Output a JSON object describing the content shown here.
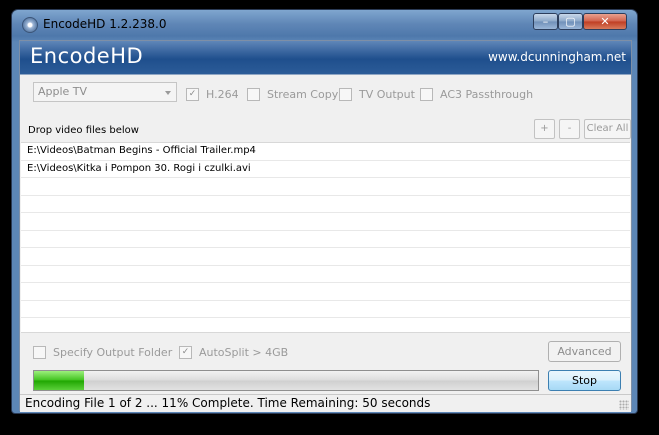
{
  "window": {
    "title": "EncodeHD 1.2.238.0",
    "controls": {
      "minimize": "–",
      "maximize": "▢",
      "close": "✕"
    }
  },
  "banner": {
    "brand": "EncodeHD",
    "website": "www.dcunningham.net"
  },
  "options": {
    "device_select": {
      "value": "Apple TV"
    },
    "h264": {
      "label": "H.264",
      "checked": true
    },
    "stream_copy": {
      "label": "Stream Copy",
      "checked": false
    },
    "tv_output": {
      "label": "TV Output",
      "checked": false
    },
    "ac3_passthrough": {
      "label": "AC3 Passthrough",
      "checked": false
    }
  },
  "files": {
    "label": "Drop video files below",
    "add_label": "+",
    "remove_label": "-",
    "clear_label": "Clear All",
    "items": [
      "E:\\Videos\\Batman Begins - Official Trailer.mp4",
      "E:\\Videos\\Kitka i Pompon 30. Rogi i czulki.avi"
    ]
  },
  "bottom": {
    "specify_output_folder": {
      "label": "Specify Output Folder",
      "checked": false
    },
    "autosplit": {
      "label": "AutoSplit > 4GB",
      "checked": true
    },
    "advanced_label": "Advanced",
    "stop_label": "Stop",
    "progress_fraction": 0.1
  },
  "status": {
    "text": "Encoding File 1 of 2 ... 11% Complete. Time Remaining: 50 seconds"
  },
  "colors": {
    "banner": "#2c5c98",
    "progress_fill": "#3ec11d"
  }
}
